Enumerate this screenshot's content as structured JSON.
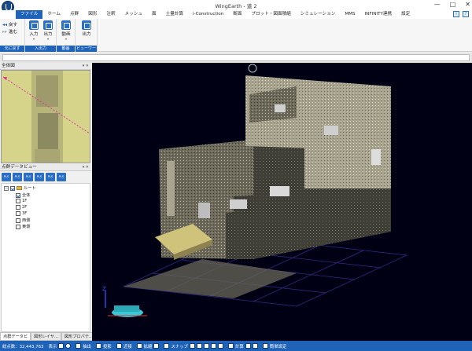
{
  "window": {
    "title": "WingEarth - 道 2",
    "controls": [
      "—",
      "□",
      "✕"
    ]
  },
  "menu": {
    "tabs": [
      "ファイル",
      "ホーム",
      "点群",
      "図形",
      "注釈",
      "メッシュ",
      "面",
      "土量計算",
      "i-Construction",
      "断面",
      "プロット・図面積縮",
      "シミュレーション",
      "MMS",
      "INFINITY連携",
      "設定"
    ],
    "active_index": 0
  },
  "ribbon": {
    "undo_group": {
      "undo": "戻す",
      "redo": "進む",
      "label": "元に戻す"
    },
    "io_group": {
      "input": "入力",
      "output": "出力",
      "label": "入出力"
    },
    "video_group": {
      "video": "動画",
      "label": "動画"
    },
    "viewer_group": {
      "output": "出力",
      "label": "ビューワー"
    }
  },
  "panels": {
    "overview_title": "全体図",
    "pointdata_title": "点群データビュー",
    "panel_controls": "▾ ✕",
    "toolbar": [
      "PLS",
      "PLS",
      "PLS",
      "PLS",
      "PLS",
      "PLS"
    ],
    "tree": {
      "root": "ルート",
      "items": [
        {
          "label": "全体",
          "checked": true
        },
        {
          "label": "1F",
          "checked": false
        },
        {
          "label": "2F",
          "checked": false
        },
        {
          "label": "3F",
          "checked": false
        },
        {
          "label": "西側",
          "checked": false
        },
        {
          "label": "東側",
          "checked": false
        }
      ]
    },
    "bottom_tabs": [
      "点群データビ",
      "図形レイヤ...",
      "図形プロパテ..."
    ]
  },
  "viewport": {
    "axis_label": "Z",
    "background": "#000015"
  },
  "status": {
    "point_count": "総点数：32,443,763",
    "items": [
      "表示",
      "抽出",
      "投影",
      "近接",
      "拡縮",
      "スナップ",
      "計算",
      "簡単設定"
    ]
  },
  "colors": {
    "accent": "#1f63b8",
    "overview_bg": "#d8d68a"
  }
}
